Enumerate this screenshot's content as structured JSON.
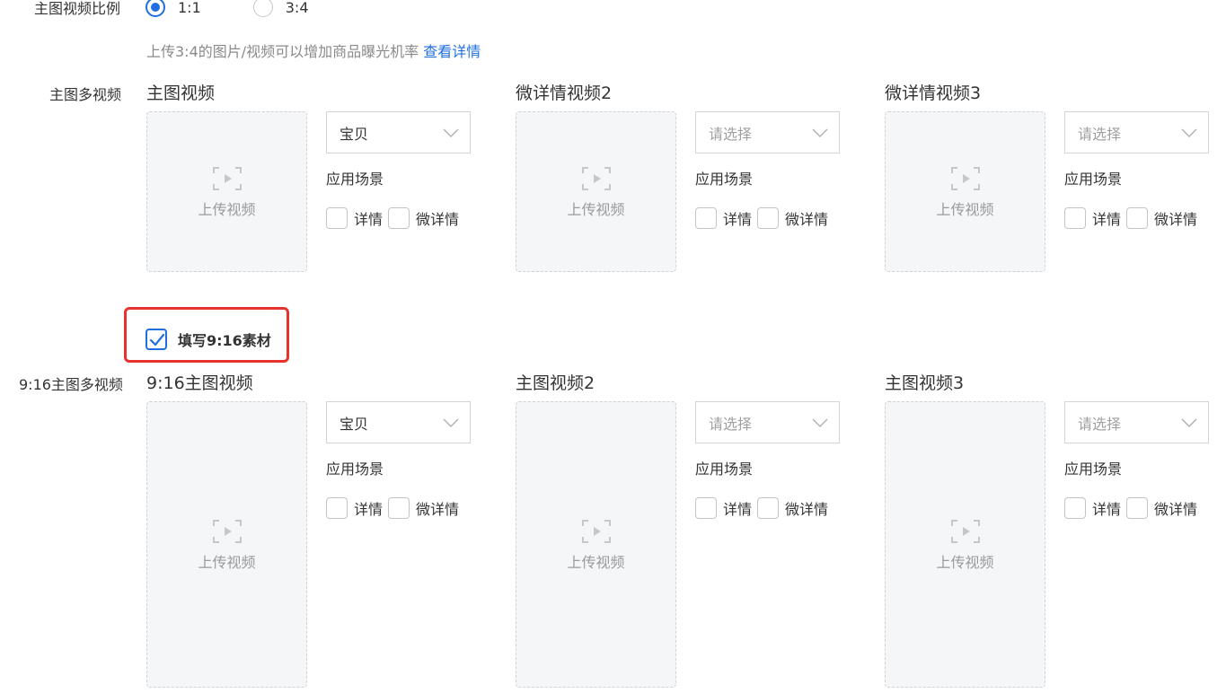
{
  "ratio": {
    "label": "主图视频比例",
    "options": [
      "1:1",
      "3:4"
    ],
    "selected": "1:1"
  },
  "hint": {
    "text": "上传3:4的图片/视频可以增加商品曝光机率",
    "link": "查看详情"
  },
  "section1": {
    "label": "主图多视频",
    "groups": [
      {
        "title": "主图视频",
        "upload": "上传视频",
        "select": "宝贝",
        "placeholder": false,
        "scene": "应用场景",
        "opts": [
          "详情",
          "微详情"
        ]
      },
      {
        "title": "微详情视频2",
        "upload": "上传视频",
        "select": "请选择",
        "placeholder": true,
        "scene": "应用场景",
        "opts": [
          "详情",
          "微详情"
        ]
      },
      {
        "title": "微详情视频3",
        "upload": "上传视频",
        "select": "请选择",
        "placeholder": true,
        "scene": "应用场景",
        "opts": [
          "详情",
          "微详情"
        ]
      }
    ]
  },
  "toggle916": {
    "label": "填写9:16素材",
    "checked": true
  },
  "section2": {
    "label": "9:16主图多视频",
    "groups": [
      {
        "title": "9:16主图视频",
        "upload": "上传视频",
        "select": "宝贝",
        "placeholder": false,
        "scene": "应用场景",
        "opts": [
          "详情",
          "微详情"
        ]
      },
      {
        "title": "主图视频2",
        "upload": "上传视频",
        "select": "请选择",
        "placeholder": true,
        "scene": "应用场景",
        "opts": [
          "详情",
          "微详情"
        ]
      },
      {
        "title": "主图视频3",
        "upload": "上传视频",
        "select": "请选择",
        "placeholder": true,
        "scene": "应用场景",
        "opts": [
          "详情",
          "微详情"
        ]
      }
    ]
  },
  "colors": {
    "accent": "#1f6fe0",
    "highlight": "#e8322e"
  },
  "icons": {
    "upload": "video-upload-icon",
    "select": "chevron-down-icon",
    "check": "check-icon"
  }
}
